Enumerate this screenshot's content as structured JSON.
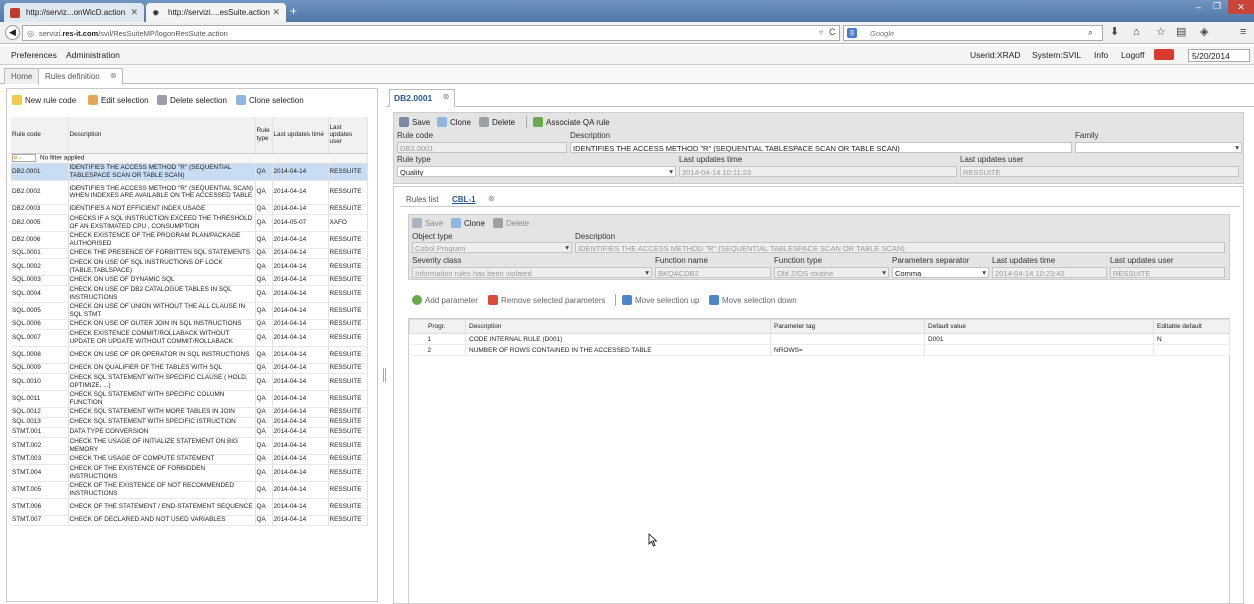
{
  "browser": {
    "tabs": [
      {
        "title": "http://serviz...onWicD.action"
      },
      {
        "title": "http://servizi....esSuite.action"
      }
    ],
    "url_prefix": "servizi.",
    "url_domain": "res-it.com",
    "url_path": "/svil/ResSuiteMP/logonResSuite.action",
    "search_placeholder": "Google"
  },
  "menu": {
    "preferences": "Preferences",
    "administration": "Administration",
    "userid": "Userid:XRAD",
    "system": "System:SVIL",
    "info": "Info",
    "logoff": "Logoff",
    "date": "5/20/2014"
  },
  "app_tabs": [
    "Home",
    "Rules definition"
  ],
  "left_toolbar": {
    "new": "New rule code",
    "edit": "Edit selection",
    "delete": "Delete selection",
    "clone": "Clone selection"
  },
  "rules_table": {
    "headers": [
      "Rule code",
      "Description",
      "Rule type",
      "Last updates time",
      "Last updates user"
    ],
    "filter_text": "No filter applied",
    "rows": [
      {
        "code": "DB2.0001",
        "desc": "IDENTIFIES THE ACCESS METHOD \"R\" (SEQUENTIAL TABLESPACE SCAN OR TABLE SCAN)",
        "type": "QA",
        "time": "2014-04-14",
        "user": "RESSUITE"
      },
      {
        "code": "DB2.0002",
        "desc": "IDENTIFIES THE ACCESS METHOD \"R\" (SEQUENTIAL SCAN) WHEN INDEXES ARE AVAILABLE ON THE ACCESSED TABLE",
        "type": "QA",
        "time": "2014-04-14",
        "user": "RESSUITE"
      },
      {
        "code": "DB2.0003",
        "desc": "IDENTIFIES A NOT EFFICIENT INDEX USAGE",
        "type": "QA",
        "time": "2014-04-14",
        "user": "RESSUITE"
      },
      {
        "code": "DB2.0005",
        "desc": "CHECKS IF A SQL INSTRUCTION EXCEED THE THRESHOLD OF AN EXSTIMATED CPU , CONSUMPTION",
        "type": "QA",
        "time": "2014-05-07",
        "user": "XAFO"
      },
      {
        "code": "DB2.0006",
        "desc": "CHECK EXISTENCE OF THE PROGRAM PLAN/PACKAGE AUTHORISED",
        "type": "QA",
        "time": "2014-04-14",
        "user": "RESSUITE"
      },
      {
        "code": "SQL.0001",
        "desc": "CHECK THE PRESENCE OF FORBITTEN SQL STATEMENTS",
        "type": "QA",
        "time": "2014-04-14",
        "user": "RESSUITE"
      },
      {
        "code": "SQL.0002",
        "desc": "CHECK ON USE OF SQL INSTRUCTIONS OF LOCK (TABLE,TABLSPACE)",
        "type": "QA",
        "time": "2014-04-14",
        "user": "RESSUITE"
      },
      {
        "code": "SQL.0003",
        "desc": "CHECK ON USE OF DYNAMIC SQL",
        "type": "QA",
        "time": "2014-04-14",
        "user": "RESSUITE"
      },
      {
        "code": "SQL.0004",
        "desc": "CHECK ON USE OF DB2 CATALOGUE TABLES IN SQL INSTRUCTIONS",
        "type": "QA",
        "time": "2014-04-14",
        "user": "RESSUITE"
      },
      {
        "code": "SQL.0005",
        "desc": "CHECK ON USE OF UNION WITHOUT THE ALL CLAUSE IN SQL STMT",
        "type": "QA",
        "time": "2014-04-14",
        "user": "RESSUITE"
      },
      {
        "code": "SQL.0006",
        "desc": "CHECK ON USE OF OUTER JOIN IN SQL INSTRUCTIONS",
        "type": "QA",
        "time": "2014-04-14",
        "user": "RESSUITE"
      },
      {
        "code": "SQL.0007",
        "desc": "CHECK EXISTENCE COMMIT/ROLLABACK WITHOUT UPDATE OR UPDATE WITHOUT COMMIT/ROLLABACK",
        "type": "QA",
        "time": "2014-04-14",
        "user": "RESSUITE"
      },
      {
        "code": "SQL.0008",
        "desc": "CHECK ON USE OF OR OPERATOR IN SQL INSTRUCTIONS",
        "type": "QA",
        "time": "2014-04-14",
        "user": "RESSUITE"
      },
      {
        "code": "SQL.0009",
        "desc": "CHECK ON QUALIFIER OF THE TABLES WITH SQL",
        "type": "QA",
        "time": "2014-04-14",
        "user": "RESSUITE"
      },
      {
        "code": "SQL.0010",
        "desc": "CHECK SQL STATEMENT WITH SPECIFIC CLAUSE ( HOLD, OPTIMIZE, ...)",
        "type": "QA",
        "time": "2014-04-14",
        "user": "RESSUITE"
      },
      {
        "code": "SQL.0011",
        "desc": "CHECK SQL STATEMENT WITH SPECIFIC COLUMN FUNCTION",
        "type": "QA",
        "time": "2014-04-14",
        "user": "RESSUITE"
      },
      {
        "code": "SQL.0012",
        "desc": "CHECK SQL STATEMENT WITH MORE TABLES IN JOIN",
        "type": "QA",
        "time": "2014-04-14",
        "user": "RESSUITE"
      },
      {
        "code": "SQL.0013",
        "desc": "CHECK SQL STATEMENT WITH SPECIFIC ISTRUCTION",
        "type": "QA",
        "time": "2014-04-14",
        "user": "RESSUITE"
      },
      {
        "code": "STMT.001",
        "desc": "DATA TYPE CONVERSION",
        "type": "QA",
        "time": "2014-04-14",
        "user": "RESSUITE"
      },
      {
        "code": "STMT.002",
        "desc": "CHECK THE USAGE OF INITIALIZE STATEMENT ON BIG MEMORY",
        "type": "QA",
        "time": "2014-04-14",
        "user": "RESSUITE"
      },
      {
        "code": "STMT.003",
        "desc": "CHECK THE USAGE OF COMPUTE STATEMENT",
        "type": "QA",
        "time": "2014-04-14",
        "user": "RESSUITE"
      },
      {
        "code": "STMT.004",
        "desc": "CHECK OF THE EXISTENCE OF FORBIDDEN INSTRUCTIONS",
        "type": "QA",
        "time": "2014-04-14",
        "user": "RESSUITE"
      },
      {
        "code": "STMT.005",
        "desc": "CHECK OF THE EXISTENCE OF NOT RECOMMENDED INSTRUCTIONS",
        "type": "QA",
        "time": "2014-04-14",
        "user": "RESSUITE"
      },
      {
        "code": "STMT.006",
        "desc": "CHECK OF THE STATEMENT / END-STATEMENT SEQUENCE",
        "type": "QA",
        "time": "2014-04-14",
        "user": "RESSUITE"
      },
      {
        "code": "STMT.007",
        "desc": "CHECK OF DECLARED AND NOT USED VARIABLES",
        "type": "QA",
        "time": "2014-04-14",
        "user": "RESSUITE"
      }
    ]
  },
  "detail": {
    "tab_title": "DB2.0001",
    "toolbar": {
      "save": "Save",
      "clone": "Clone",
      "delete": "Delete",
      "associate": "Associate QA rule"
    },
    "labels": {
      "rule_code": "Rule code",
      "description": "Description",
      "family": "Family",
      "rule_type": "Rule type",
      "last_time": "Last updates time",
      "last_user": "Last updates user"
    },
    "values": {
      "rule_code": "DB2.0001",
      "description": "IDENTIFIES THE ACCESS METHOD \"R\" (SEQUENTIAL TABLESPACE SCAN OR TABLE   SCAN)",
      "family": "",
      "rule_type": "Quality",
      "last_time": "2014-04-14 10:11:23",
      "last_user": "RESSUITE"
    }
  },
  "sub": {
    "tabs": [
      "Rules list",
      "CBL-1"
    ],
    "toolbar": {
      "save": "Save",
      "clone": "Clone",
      "delete": "Delete"
    },
    "labels": {
      "object_type": "Object type",
      "description": "Description",
      "severity": "Severity class",
      "function_name": "Function name",
      "function_type": "Function type",
      "separator": "Parameters separator",
      "last_time": "Last updates time",
      "last_user": "Last updates user"
    },
    "values": {
      "object_type": "Cobol Program",
      "description": "IDENTIFIES THE ACCESS METHOD \"R\" (SEQUENTIAL TABLESPACE SCAN OR TABLE   SCAN)",
      "severity": "Information rules has been violated",
      "function_name": "BKQACDB2",
      "function_type": "Old Z/OS routine",
      "separator": "Comma",
      "last_time": "2014-04-14 10:23:42",
      "last_user": "RESSUITE"
    },
    "param_toolbar": {
      "add": "Add parameter",
      "remove": "Remove selected parameters",
      "up": "Move selection up",
      "down": "Move selection down"
    },
    "param_table": {
      "headers": [
        "Progr.",
        "Description",
        "Parameter tag",
        "Default value",
        "Editable default"
      ],
      "rows": [
        {
          "progr": "1",
          "desc": "CODE INTERNAL RULE (D001)",
          "tag": "",
          "default": "D001",
          "editable": "N"
        },
        {
          "progr": "2",
          "desc": "NUMBER OF ROWS CONTAINED IN THE ACCESSED TABLE",
          "tag": "NROWS=",
          "default": "",
          "editable": ""
        }
      ]
    }
  }
}
